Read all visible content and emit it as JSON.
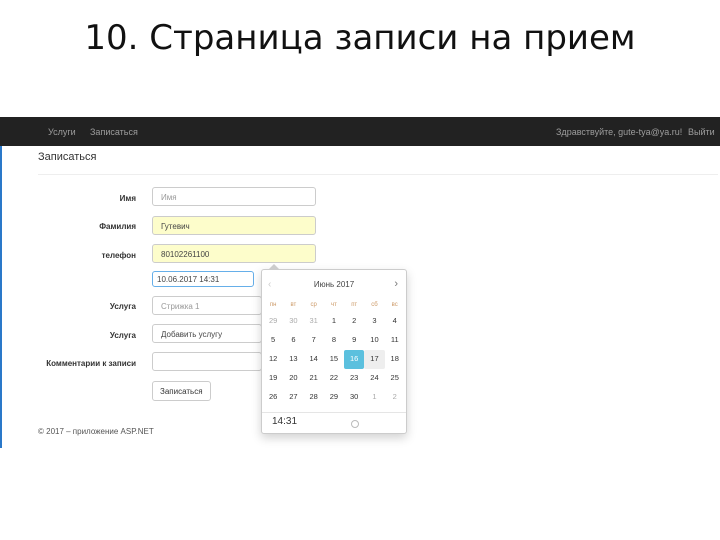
{
  "slide": {
    "title": "10. Страница записи на прием"
  },
  "nav": {
    "services": "Услуги",
    "signup": "Записаться",
    "greeting": "Здравствуйте, gute-tya@ya.ru!",
    "logout": "Выйти"
  },
  "page": {
    "heading": "Записаться"
  },
  "form": {
    "name": {
      "label": "Имя",
      "placeholder": "Имя"
    },
    "surname": {
      "label": "Фамилия",
      "value": "Гутевич"
    },
    "phone": {
      "label": "телефон",
      "value": "80102261100"
    },
    "datetime": {
      "value": "10.06.2017 14:31"
    },
    "service1": {
      "label": "Услуга",
      "value": "Стрижка 1"
    },
    "service2": {
      "label": "Услуга",
      "value": "Добавить услугу"
    },
    "comment": {
      "label": "Комментарии к записи",
      "value": ""
    },
    "submit_label": "Записаться"
  },
  "datepicker": {
    "month_title": "Июнь 2017",
    "prev_glyph": "‹",
    "next_glyph": "›",
    "weekdays": [
      "пн",
      "вт",
      "ср",
      "чт",
      "пт",
      "сб",
      "вс"
    ],
    "weeks": [
      [
        "29",
        "30",
        "31",
        "1",
        "2",
        "3",
        "4"
      ],
      [
        "5",
        "6",
        "7",
        "8",
        "9",
        "10",
        "11"
      ],
      [
        "12",
        "13",
        "14",
        "15",
        "16",
        "17",
        "18"
      ],
      [
        "19",
        "20",
        "21",
        "22",
        "23",
        "24",
        "25"
      ],
      [
        "26",
        "27",
        "28",
        "29",
        "30",
        "1",
        "2"
      ]
    ],
    "selected_day": "16",
    "time": "14:31"
  },
  "footer": {
    "text": "© 2017 – приложение ASP.NET"
  },
  "colors": {
    "navbar": "#222222",
    "selected_day": "#5bc0de",
    "autofill": "#fdfdcb"
  }
}
